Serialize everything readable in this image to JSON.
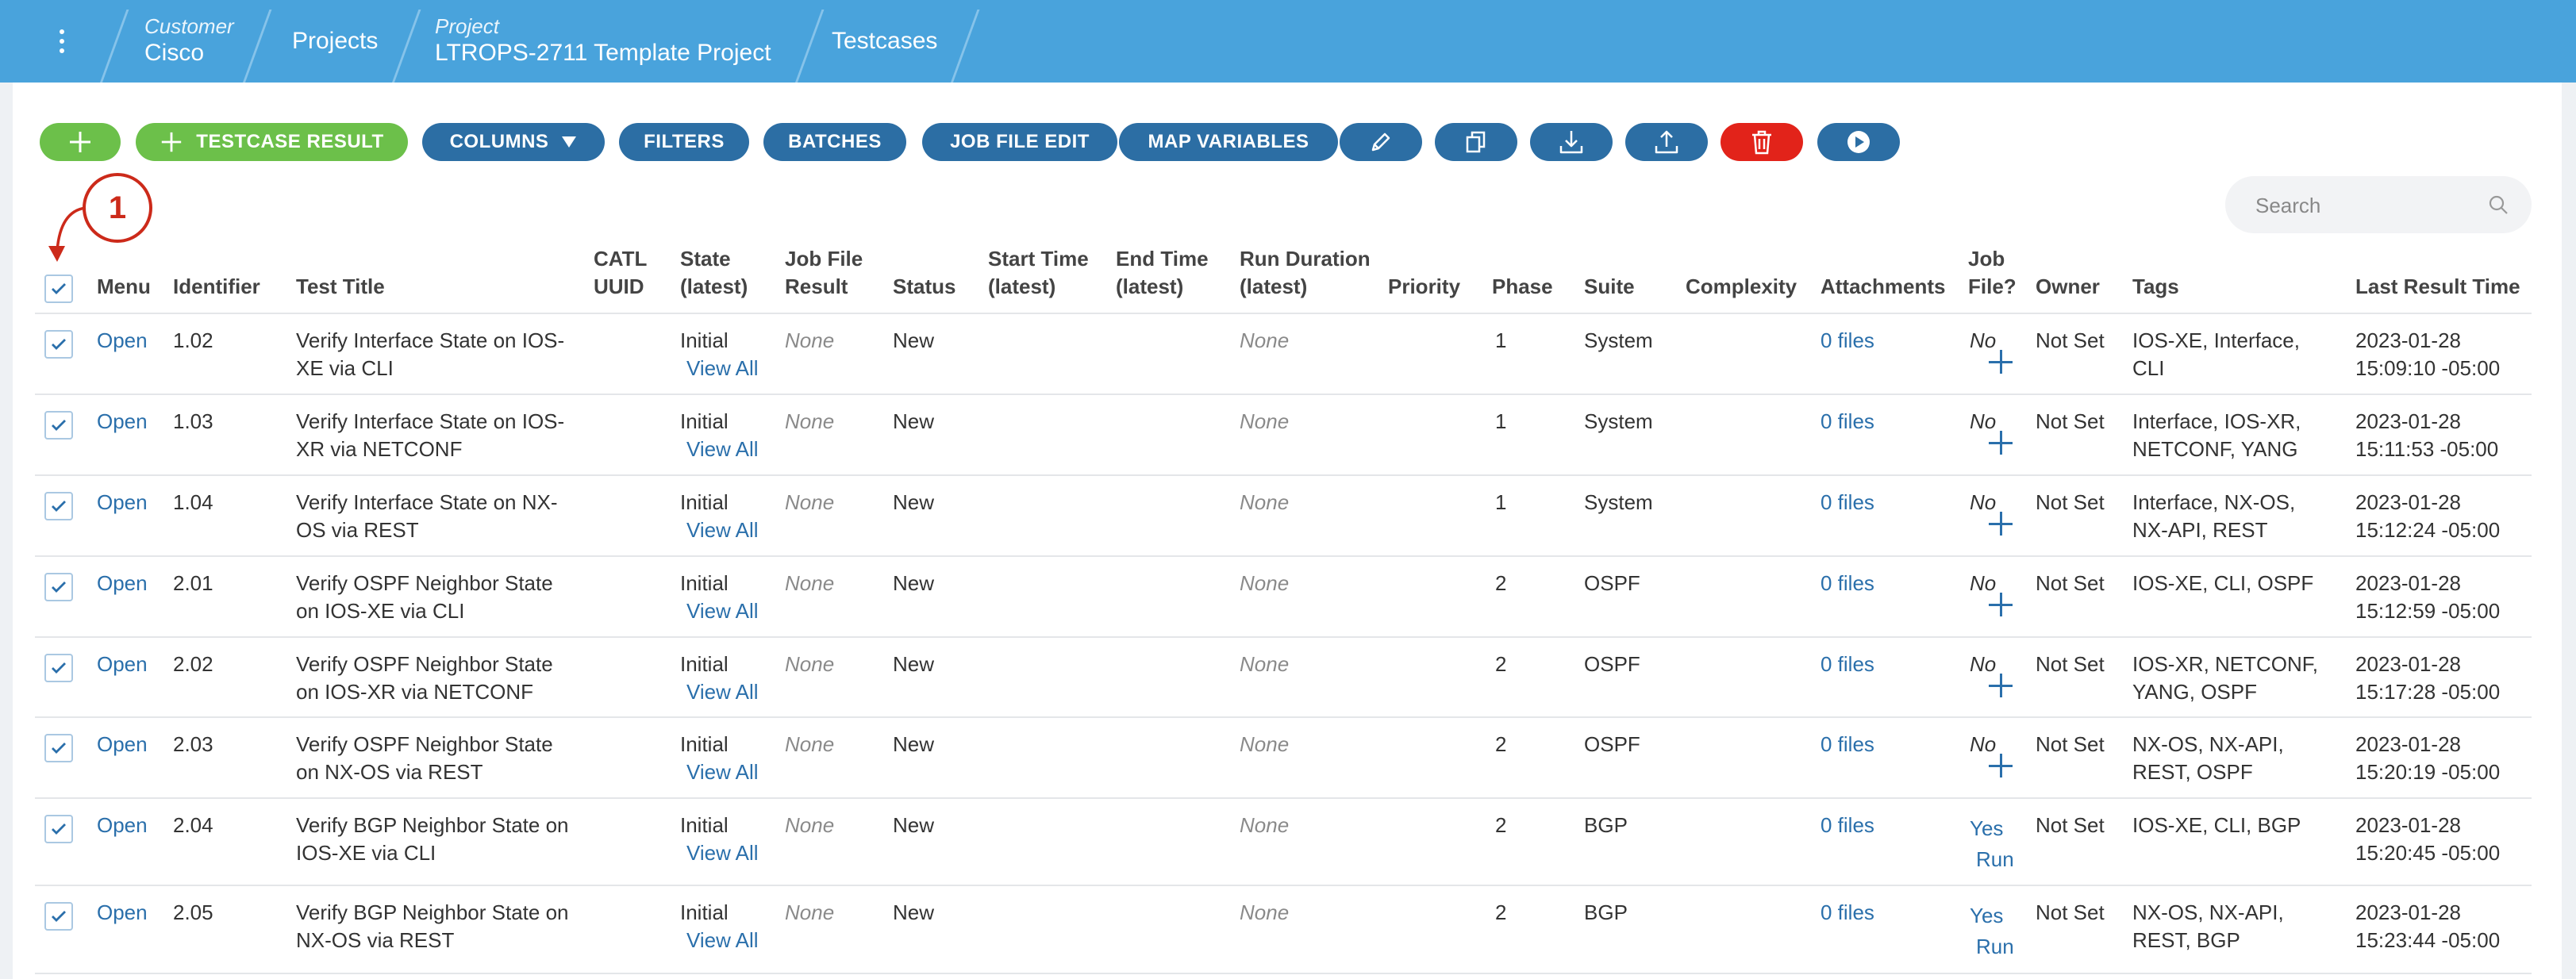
{
  "breadcrumb": {
    "customer_label": "Customer",
    "customer": "Cisco",
    "projects": "Projects",
    "project_label": "Project",
    "project": "LTROPS-2711 Template Project",
    "testcases": "Testcases"
  },
  "toolbar": {
    "testcase_result": "TESTCASE RESULT",
    "columns": "COLUMNS",
    "filters": "FILTERS",
    "batches": "BATCHES",
    "job_file_edit": "JOB FILE EDIT",
    "map_variables": "MAP VARIABLES"
  },
  "colors": {
    "topbar": "#49a3dc",
    "primary": "#2c6ea4",
    "success": "#6cc04a",
    "danger": "#e2231a",
    "link": "#2a6fab",
    "callout": "#cc2a1a"
  },
  "search": {
    "placeholder": "Search"
  },
  "callout": {
    "number": "1"
  },
  "columns": {
    "menu": "Menu",
    "identifier": "Identifier",
    "test_title": "Test Title",
    "catl_1": "CATL",
    "catl_2": "UUID",
    "state_1": "State",
    "state_2": "(latest)",
    "jfr_1": "Job File",
    "jfr_2": "Result",
    "status": "Status",
    "start_1": "Start Time",
    "start_2": "(latest)",
    "end_1": "End Time",
    "end_2": "(latest)",
    "dur_1": "Run Duration",
    "dur_2": "(latest)",
    "priority": "Priority",
    "phase": "Phase",
    "suite": "Suite",
    "complexity": "Complexity",
    "attachments": "Attachments",
    "jobfile_1": "Job",
    "jobfile_2": "File?",
    "owner": "Owner",
    "tags": "Tags",
    "last_result": "Last Result Time"
  },
  "rows": [
    {
      "menu": "Open",
      "id": "1.02",
      "title_1": "Verify Interface State on IOS-",
      "title_2": "XE via CLI",
      "state": "Initial",
      "view_all": "View All",
      "job_file_result": "None",
      "status": "New",
      "duration": "None",
      "phase": "1",
      "suite": "System",
      "attachments": "0 files",
      "job_file": "No",
      "owner": "Not Set",
      "tags_1": "IOS-XE, Interface,",
      "tags_2": "CLI",
      "date": "2023-01-28",
      "time": "15:09:10 -05:00"
    },
    {
      "menu": "Open",
      "id": "1.03",
      "title_1": "Verify Interface State on IOS-",
      "title_2": "XR via NETCONF",
      "state": "Initial",
      "view_all": "View All",
      "job_file_result": "None",
      "status": "New",
      "duration": "None",
      "phase": "1",
      "suite": "System",
      "attachments": "0 files",
      "job_file": "No",
      "owner": "Not Set",
      "tags_1": "Interface, IOS-XR,",
      "tags_2": "NETCONF, YANG",
      "date": "2023-01-28",
      "time": "15:11:53 -05:00"
    },
    {
      "menu": "Open",
      "id": "1.04",
      "title_1": "Verify Interface State on NX-",
      "title_2": "OS via REST",
      "state": "Initial",
      "view_all": "View All",
      "job_file_result": "None",
      "status": "New",
      "duration": "None",
      "phase": "1",
      "suite": "System",
      "attachments": "0 files",
      "job_file": "No",
      "owner": "Not Set",
      "tags_1": "Interface, NX-OS,",
      "tags_2": "NX-API, REST",
      "date": "2023-01-28",
      "time": "15:12:24 -05:00"
    },
    {
      "menu": "Open",
      "id": "2.01",
      "title_1": "Verify OSPF Neighbor State",
      "title_2": "on IOS-XE via CLI",
      "state": "Initial",
      "view_all": "View All",
      "job_file_result": "None",
      "status": "New",
      "duration": "None",
      "phase": "2",
      "suite": "OSPF",
      "attachments": "0 files",
      "job_file": "No",
      "owner": "Not Set",
      "tags_1": "IOS-XE, CLI, OSPF",
      "tags_2": "",
      "date": "2023-01-28",
      "time": "15:12:59 -05:00"
    },
    {
      "menu": "Open",
      "id": "2.02",
      "title_1": "Verify OSPF Neighbor State",
      "title_2": "on IOS-XR via NETCONF",
      "state": "Initial",
      "view_all": "View All",
      "job_file_result": "None",
      "status": "New",
      "duration": "None",
      "phase": "2",
      "suite": "OSPF",
      "attachments": "0 files",
      "job_file": "No",
      "owner": "Not Set",
      "tags_1": "IOS-XR, NETCONF,",
      "tags_2": "YANG, OSPF",
      "date": "2023-01-28",
      "time": "15:17:28 -05:00"
    },
    {
      "menu": "Open",
      "id": "2.03",
      "title_1": "Verify OSPF Neighbor State",
      "title_2": "on NX-OS via REST",
      "state": "Initial",
      "view_all": "View All",
      "job_file_result": "None",
      "status": "New",
      "duration": "None",
      "phase": "2",
      "suite": "OSPF",
      "attachments": "0 files",
      "job_file": "No",
      "owner": "Not Set",
      "tags_1": "NX-OS, NX-API,",
      "tags_2": "REST, OSPF",
      "date": "2023-01-28",
      "time": "15:20:19 -05:00"
    },
    {
      "menu": "Open",
      "id": "2.04",
      "title_1": "Verify BGP Neighbor State on",
      "title_2": "IOS-XE via CLI",
      "state": "Initial",
      "view_all": "View All",
      "job_file_result": "None",
      "status": "New",
      "duration": "None",
      "phase": "2",
      "suite": "BGP",
      "attachments": "0 files",
      "job_file": "Yes",
      "run": "Run",
      "owner": "Not Set",
      "tags_1": "IOS-XE, CLI, BGP",
      "tags_2": "",
      "date": "2023-01-28",
      "time": "15:20:45 -05:00"
    },
    {
      "menu": "Open",
      "id": "2.05",
      "title_1": "Verify BGP Neighbor State on",
      "title_2": "NX-OS via REST",
      "state": "Initial",
      "view_all": "View All",
      "job_file_result": "None",
      "status": "New",
      "duration": "None",
      "phase": "2",
      "suite": "BGP",
      "attachments": "0 files",
      "job_file": "Yes",
      "run": "Run",
      "owner": "Not Set",
      "tags_1": "NX-OS, NX-API,",
      "tags_2": "REST, BGP",
      "date": "2023-01-28",
      "time": "15:23:44 -05:00"
    }
  ]
}
